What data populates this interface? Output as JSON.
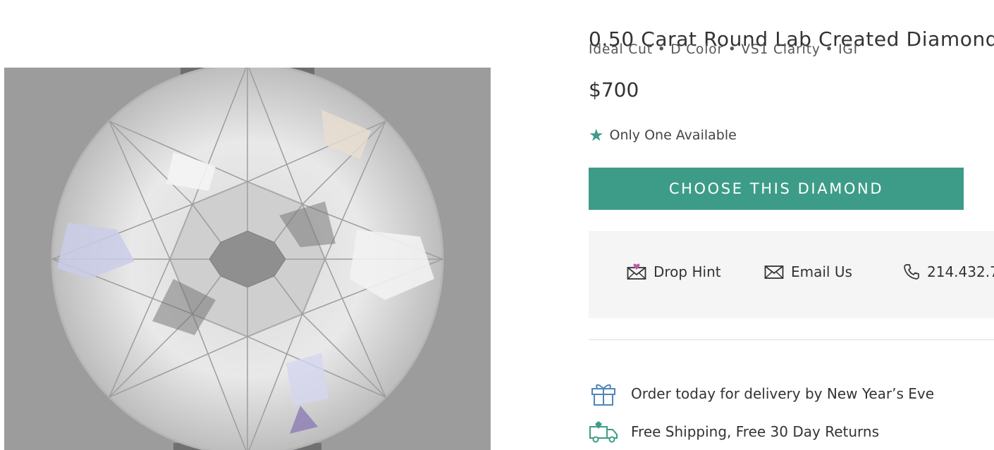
{
  "product": {
    "title": "0.50 Carat Round Lab Created Diamond",
    "subtitle": "Ideal Cut • D Color • VS1 Clarity • IGI",
    "price": "$700",
    "availability": "Only One Available",
    "image_icon": "diamond-photo"
  },
  "cta": {
    "label": "CHOOSE THIS DIAMOND"
  },
  "contact": {
    "drop_hint": "Drop Hint",
    "email_us": "Email Us",
    "phone": "214.432.7"
  },
  "perks": {
    "delivery": "Order today for delivery by New Year’s Eve",
    "shipping": "Free Shipping, Free 30 Day Returns"
  },
  "colors": {
    "accent": "#3d9c88",
    "image_bg": "#9a9a9a",
    "contact_bg": "#f5f5f5",
    "hint_heart": "#c05aa0"
  }
}
